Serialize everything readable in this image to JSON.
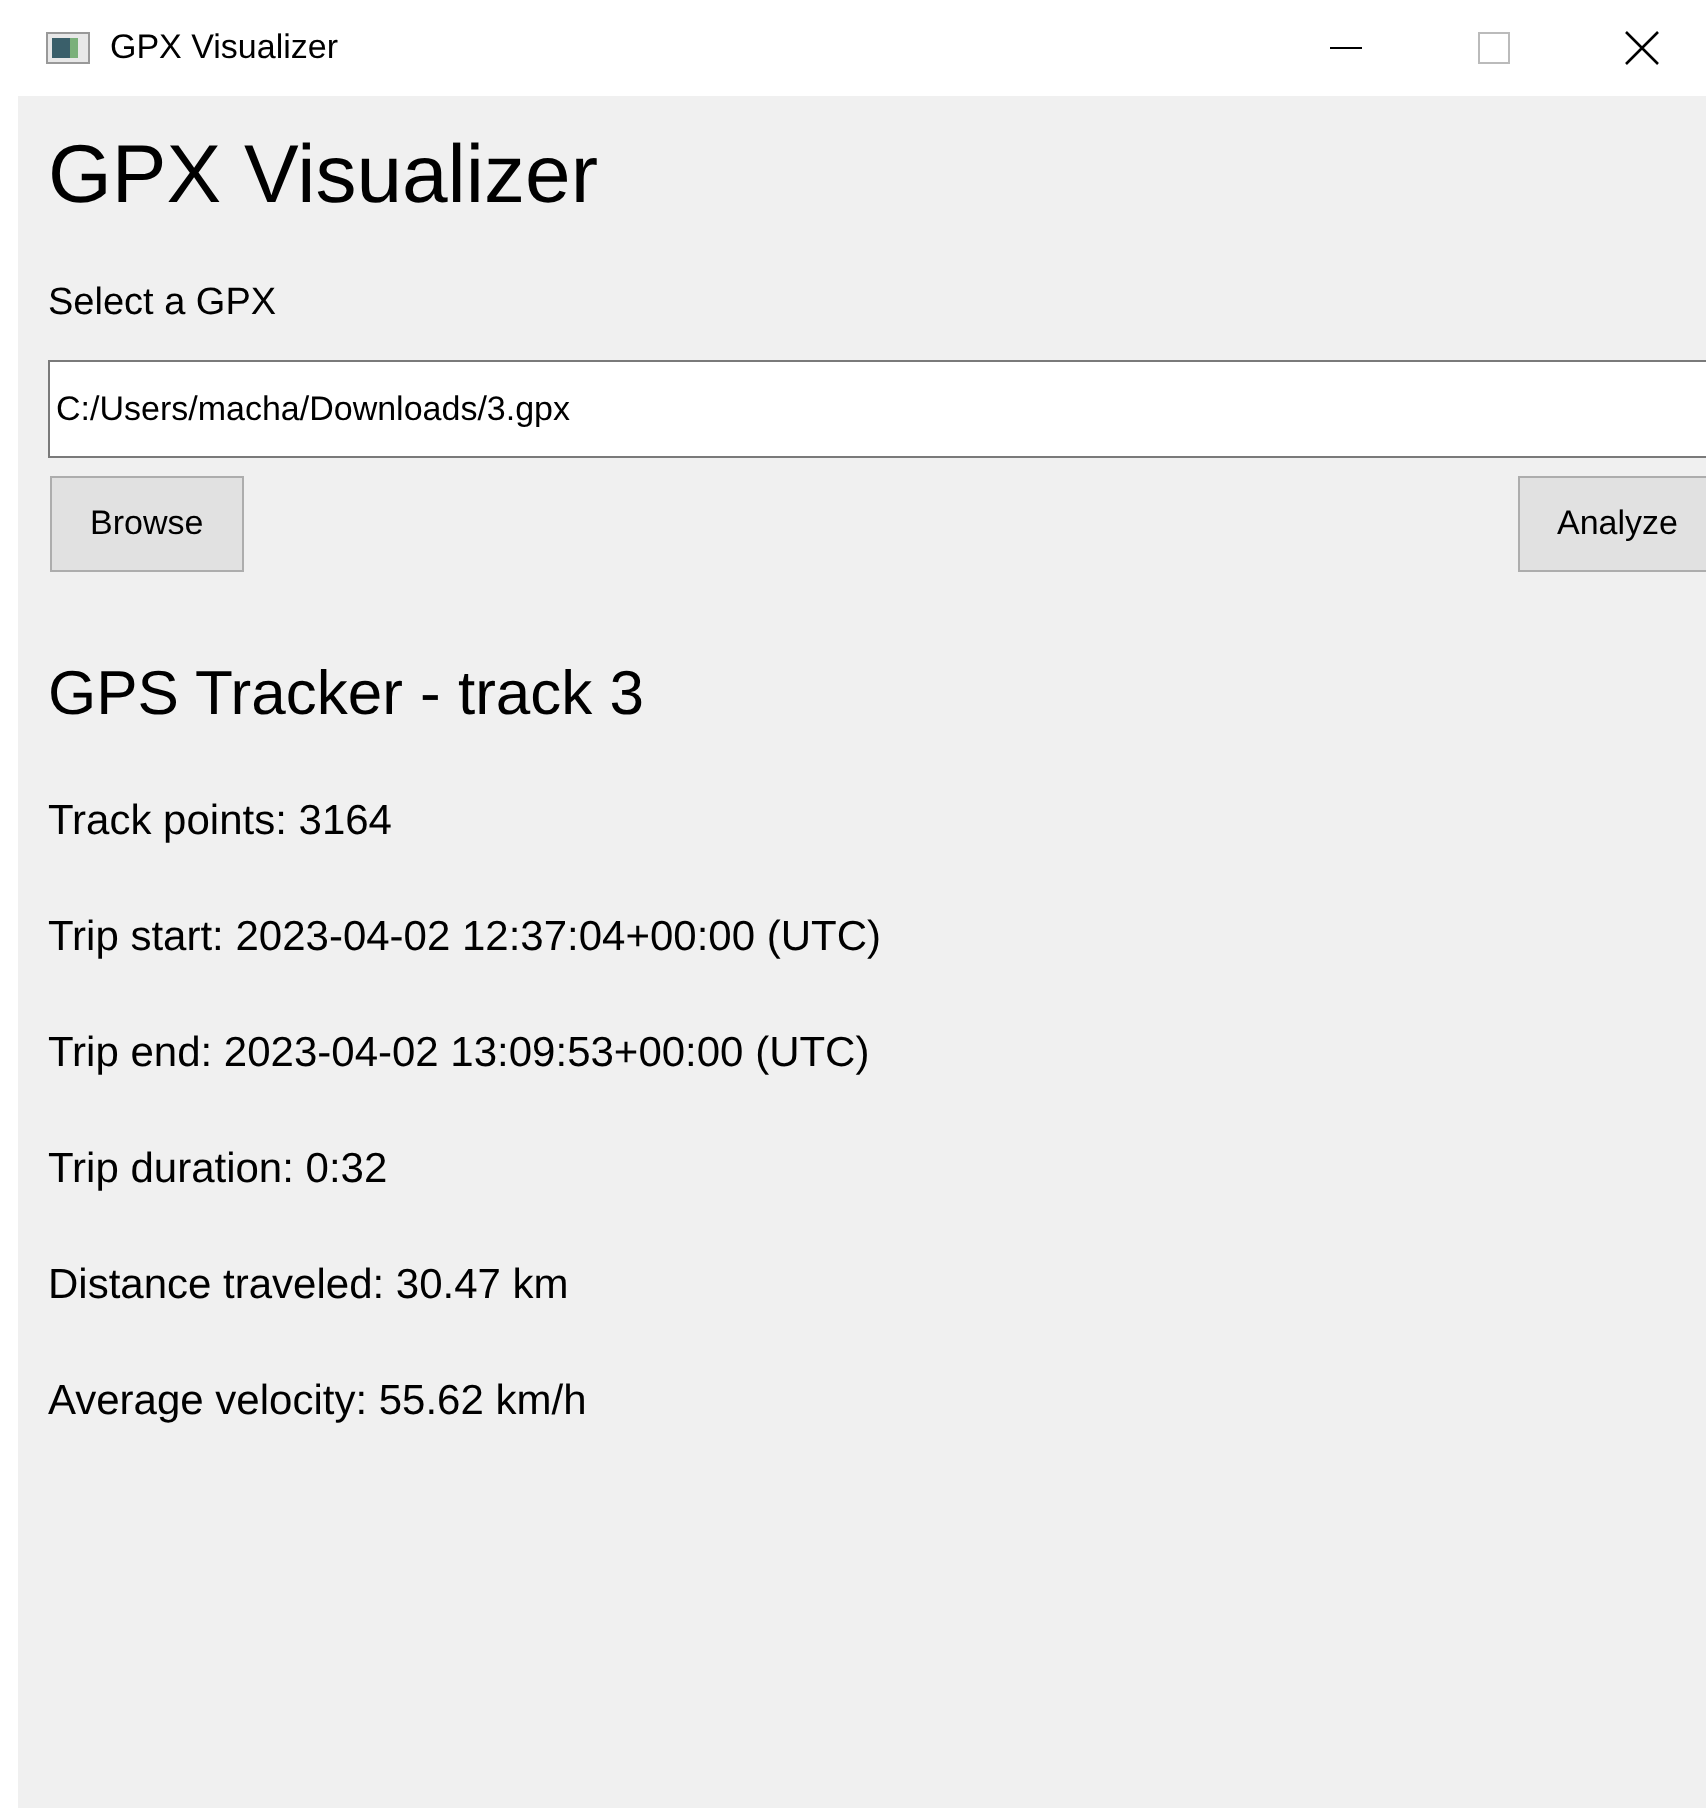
{
  "window": {
    "title": "GPX Visualizer"
  },
  "heading": "GPX Visualizer",
  "file_label": "Select a GPX",
  "file_field": {
    "value": "C:/Users/macha/Downloads/3.gpx"
  },
  "buttons": [
    {
      "label": "Browse"
    },
    {
      "label": "Analyze"
    }
  ],
  "track_title": "GPS Tracker - track 3",
  "stats": [
    "Track points: 3164",
    "Trip start: 2023-04-02 12:37:04+00:00 (UTC)",
    "Trip end: 2023-04-02 13:09:53+00:00 (UTC)",
    "Trip duration: 0:32",
    "Distance traveled: 30.47 km",
    "Average velocity: 55.62 km/h"
  ]
}
